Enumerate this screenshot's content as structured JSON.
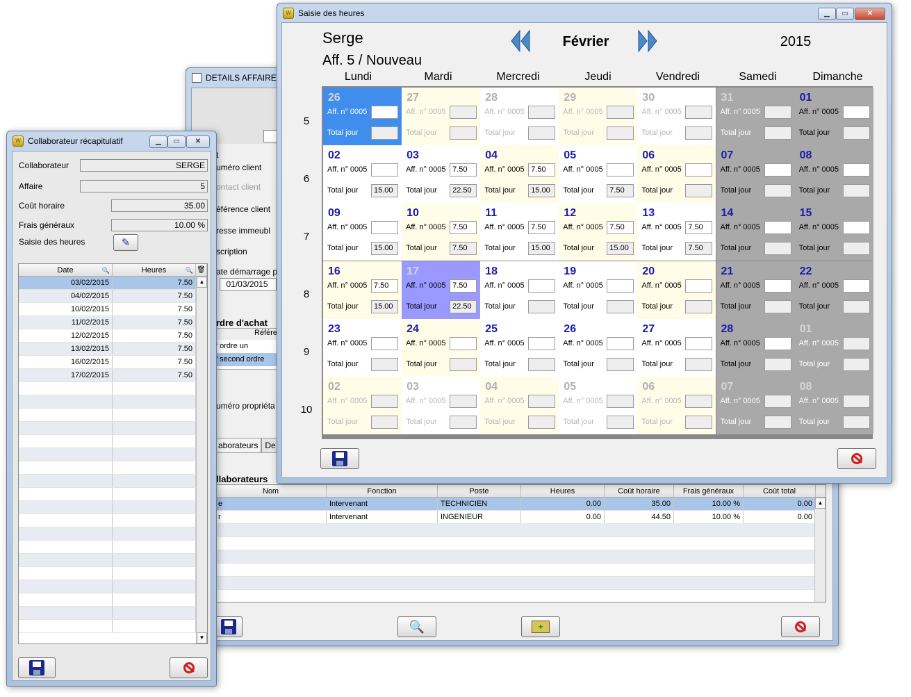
{
  "details": {
    "title": "DETAILS AFFAIRE N",
    "labels": [
      "t",
      "uméro client",
      "ontact client",
      "éférence client",
      "resse immeubl",
      "scription",
      "ate démarrage p"
    ],
    "date_value": "01/03/2015",
    "ordre_title": "rdre d'achat",
    "ordre_col": "Référe",
    "ordre_rows": [
      "f ordre un",
      "f second ordre"
    ],
    "prop_label": "uméro propriéta",
    "tabs": [
      "aborateurs",
      "De"
    ],
    "collab_title": "llaborateurs",
    "table_headers": [
      "Nom",
      "Fonction",
      "Poste",
      "Heures",
      "Coût horaire",
      "Frais généraux",
      "Coût total"
    ],
    "rows": [
      {
        "nom": "e",
        "fonction": "Intervenant",
        "poste": "TECHNICIEN",
        "heures": "0.00",
        "cout": "35.00",
        "frais": "10.00 %",
        "total": "0.00"
      },
      {
        "nom": "r",
        "fonction": "Intervenant",
        "poste": "INGENIEUR",
        "heures": "0.00",
        "cout": "44.50",
        "frais": "10.00 %",
        "total": "0.00"
      }
    ]
  },
  "recap": {
    "title": "Collaborateur récapitulatif",
    "collaborateur_label": "Collaborateur",
    "collaborateur_value": "SERGE",
    "affaire_label": "Affaire",
    "affaire_value": "5",
    "cout_label": "Coût horaire",
    "cout_value": "35.00",
    "frais_label": "Frais généraux",
    "frais_value": "10.00 %",
    "saisie_label": "Saisie des heures",
    "col_date": "Date",
    "col_heures": "Heures",
    "rows": [
      {
        "date": "03/02/2015",
        "heures": "7.50"
      },
      {
        "date": "04/02/2015",
        "heures": "7.50"
      },
      {
        "date": "10/02/2015",
        "heures": "7.50"
      },
      {
        "date": "11/02/2015",
        "heures": "7.50"
      },
      {
        "date": "12/02/2015",
        "heures": "7.50"
      },
      {
        "date": "13/02/2015",
        "heures": "7.50"
      },
      {
        "date": "16/02/2015",
        "heures": "7.50"
      },
      {
        "date": "17/02/2015",
        "heures": "7.50"
      }
    ]
  },
  "saisie": {
    "title": "Saisie des heures",
    "name": "Serge",
    "affaire": "Aff. 5 / Nouveau",
    "month": "Février",
    "year": "2015",
    "days": [
      "Lundi",
      "Mardi",
      "Mercredi",
      "Jeudi",
      "Vendredi",
      "Samedi",
      "Dimanche"
    ],
    "weeks": [
      "5",
      "6",
      "7",
      "8",
      "9",
      "10"
    ],
    "aff_label": "Aff. n° 0005",
    "total_label": "Total jour",
    "cells": [
      [
        {
          "d": "26",
          "s": "blue",
          "a": "",
          "t": ""
        },
        {
          "d": "27",
          "s": "yo",
          "a": "",
          "t": ""
        },
        {
          "d": "28",
          "s": "wo",
          "a": "",
          "t": ""
        },
        {
          "d": "29",
          "s": "yo",
          "a": "",
          "t": ""
        },
        {
          "d": "30",
          "s": "wo",
          "a": "",
          "t": ""
        },
        {
          "d": "31",
          "s": "go",
          "a": "",
          "t": ""
        },
        {
          "d": "01",
          "s": "g",
          "a": "",
          "t": ""
        }
      ],
      [
        {
          "d": "02",
          "s": "w",
          "a": "",
          "t": "15.00"
        },
        {
          "d": "03",
          "s": "w",
          "a": "7.50",
          "t": "22.50"
        },
        {
          "d": "04",
          "s": "y",
          "a": "7.50",
          "t": "15.00"
        },
        {
          "d": "05",
          "s": "w",
          "a": "",
          "t": "7.50"
        },
        {
          "d": "06",
          "s": "y",
          "a": "",
          "t": ""
        },
        {
          "d": "07",
          "s": "g",
          "a": "",
          "t": ""
        },
        {
          "d": "08",
          "s": "g",
          "a": "",
          "t": ""
        }
      ],
      [
        {
          "d": "09",
          "s": "w",
          "a": "",
          "t": "15.00"
        },
        {
          "d": "10",
          "s": "y",
          "a": "7.50",
          "t": "7.50"
        },
        {
          "d": "11",
          "s": "w",
          "a": "7.50",
          "t": "15.00"
        },
        {
          "d": "12",
          "s": "y",
          "a": "7.50",
          "t": "15.00"
        },
        {
          "d": "13",
          "s": "w",
          "a": "7.50",
          "t": "7.50"
        },
        {
          "d": "14",
          "s": "g",
          "a": "",
          "t": ""
        },
        {
          "d": "15",
          "s": "g",
          "a": "",
          "t": ""
        }
      ],
      [
        {
          "d": "16",
          "s": "y",
          "a": "7.50",
          "t": "15.00"
        },
        {
          "d": "17",
          "s": "purple",
          "a": "7.50",
          "t": "22.50"
        },
        {
          "d": "18",
          "s": "w",
          "a": "",
          "t": ""
        },
        {
          "d": "19",
          "s": "w",
          "a": "",
          "t": ""
        },
        {
          "d": "20",
          "s": "y",
          "a": "",
          "t": ""
        },
        {
          "d": "21",
          "s": "g",
          "a": "",
          "t": ""
        },
        {
          "d": "22",
          "s": "g",
          "a": "",
          "t": ""
        }
      ],
      [
        {
          "d": "23",
          "s": "w",
          "a": "",
          "t": ""
        },
        {
          "d": "24",
          "s": "y",
          "a": "",
          "t": ""
        },
        {
          "d": "25",
          "s": "w",
          "a": "",
          "t": ""
        },
        {
          "d": "26",
          "s": "w",
          "a": "",
          "t": ""
        },
        {
          "d": "27",
          "s": "w",
          "a": "",
          "t": ""
        },
        {
          "d": "28",
          "s": "g",
          "a": "",
          "t": ""
        },
        {
          "d": "01",
          "s": "go",
          "a": "",
          "t": ""
        }
      ],
      [
        {
          "d": "02",
          "s": "yo",
          "a": "",
          "t": ""
        },
        {
          "d": "03",
          "s": "wo",
          "a": "",
          "t": ""
        },
        {
          "d": "04",
          "s": "yo",
          "a": "",
          "t": ""
        },
        {
          "d": "05",
          "s": "wo",
          "a": "",
          "t": ""
        },
        {
          "d": "06",
          "s": "yo",
          "a": "",
          "t": ""
        },
        {
          "d": "07",
          "s": "go",
          "a": "",
          "t": ""
        },
        {
          "d": "08",
          "s": "go",
          "a": "",
          "t": ""
        }
      ]
    ]
  }
}
